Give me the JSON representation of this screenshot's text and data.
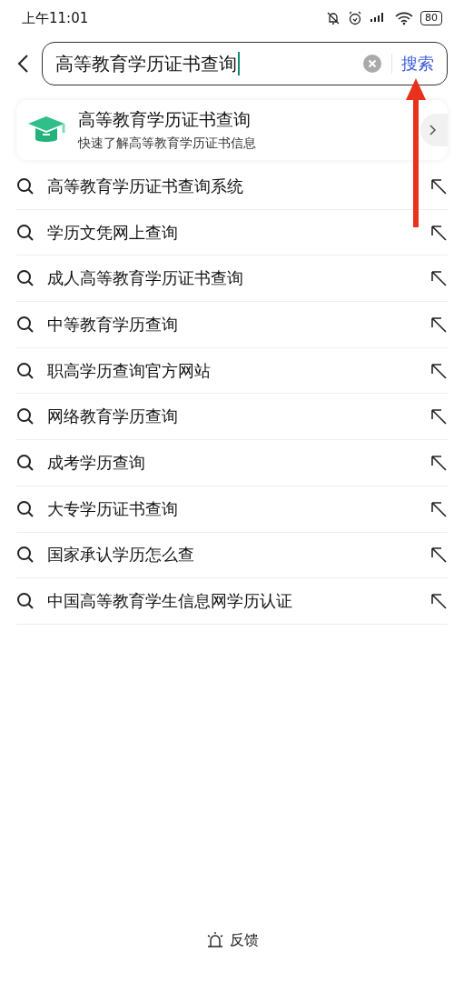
{
  "status_bar": {
    "time": "上午11:01",
    "battery": "80"
  },
  "search": {
    "value": "高等教育学历证书查询",
    "button": "搜索"
  },
  "card": {
    "title": "高等教育学历证书查询",
    "subtitle": "快速了解高等教育学历证书信息"
  },
  "suggestions": [
    {
      "text": "高等教育学历证书查询系统"
    },
    {
      "text": "学历文凭网上查询"
    },
    {
      "text": "成人高等教育学历证书查询"
    },
    {
      "text": "中等教育学历查询"
    },
    {
      "text": "职高学历查询官方网站"
    },
    {
      "text": "网络教育学历查询"
    },
    {
      "text": "成考学历查询"
    },
    {
      "text": "大专学历证书查询"
    },
    {
      "text": "国家承认学历怎么查"
    },
    {
      "text": "中国高等教育学生信息网学历认证"
    }
  ],
  "footer": {
    "label": "反馈"
  }
}
